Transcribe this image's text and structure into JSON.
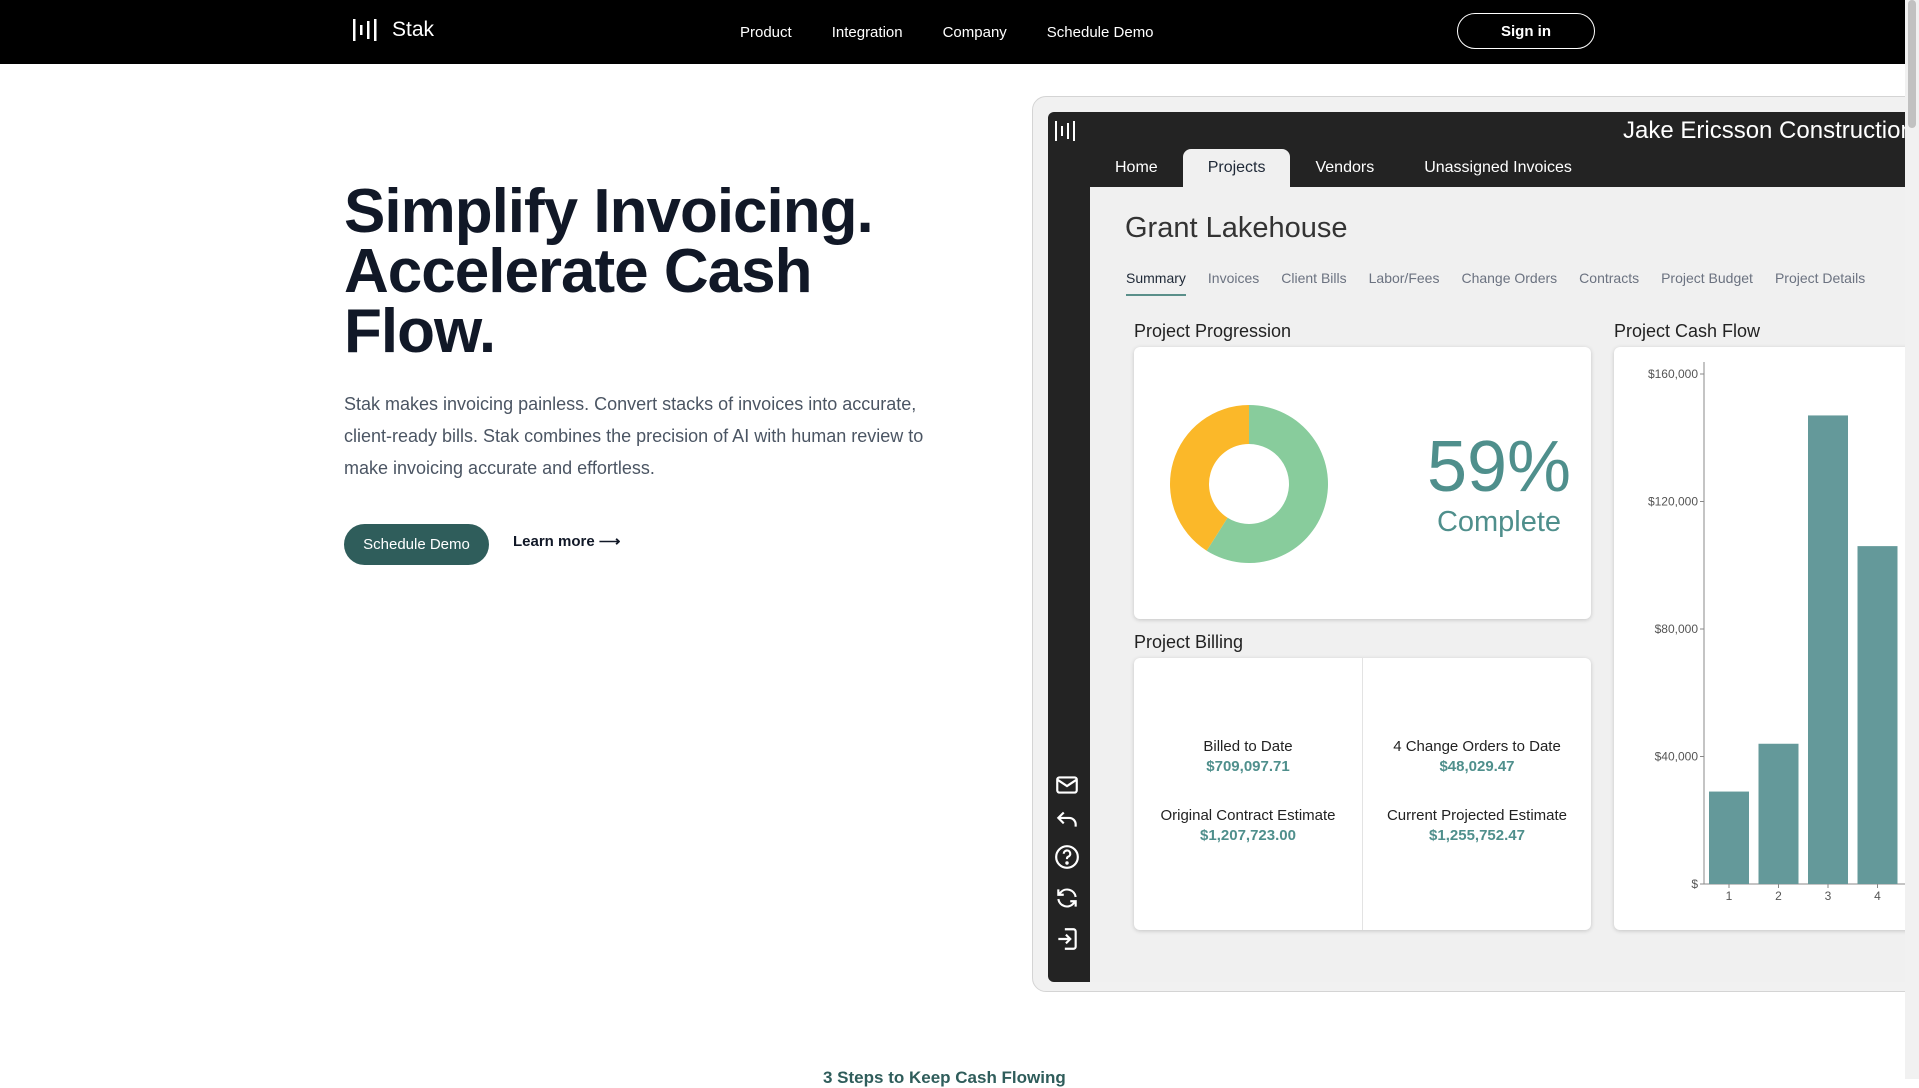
{
  "nav": {
    "logo_text": "Stak",
    "links": [
      "Product",
      "Integration",
      "Company",
      "Schedule Demo"
    ],
    "signin_label": "Sign in"
  },
  "hero": {
    "title": "Simplify Invoicing. Accelerate Cash Flow.",
    "description": "Stak makes invoicing painless. Convert stacks of invoices into accurate, client-ready bills. Stak combines the precision of AI with human review to make invoicing accurate and effortless.",
    "cta_label": "Schedule Demo",
    "learn_more_label": "Learn more ⟶"
  },
  "app": {
    "company_name": "Jake Ericsson Construction",
    "tabs": [
      "Home",
      "Projects",
      "Vendors",
      "Unassigned Invoices"
    ],
    "active_tab": "Projects",
    "project_title": "Grant Lakehouse",
    "subtabs": [
      "Summary",
      "Invoices",
      "Client Bills",
      "Labor/Fees",
      "Change Orders",
      "Contracts",
      "Project Budget",
      "Project Details"
    ],
    "active_subtab": "Summary",
    "side_icons": [
      "mail-icon",
      "undo-icon",
      "help-icon",
      "refresh-icon",
      "logout-icon"
    ],
    "progression": {
      "title": "Project Progression",
      "percent_text": "59%",
      "label": "Complete",
      "complete_fraction": 0.59,
      "colors": {
        "complete": "#88cc9c",
        "remaining": "#fbb829"
      }
    },
    "billing": {
      "title": "Project Billing",
      "items": [
        {
          "label": "Billed to Date",
          "value": "$709,097.71"
        },
        {
          "label": "4 Change Orders to Date",
          "value": "$48,029.47"
        },
        {
          "label": "Original Contract Estimate",
          "value": "$1,207,723.00"
        },
        {
          "label": "Current Projected Estimate",
          "value": "$1,255,752.47"
        }
      ]
    },
    "cash_flow_title": "Project Cash Flow"
  },
  "chart_data": {
    "type": "bar",
    "title": "Project Cash Flow",
    "categories": [
      "1",
      "2",
      "3",
      "4"
    ],
    "values": [
      29000,
      44000,
      147000,
      106000
    ],
    "ylim": [
      0,
      168000
    ],
    "yticks": [
      0,
      40000,
      80000,
      120000,
      160000
    ],
    "ytick_labels": [
      "$",
      "$40,000",
      "$80,000",
      "$120,000",
      "$160,000"
    ],
    "bar_color": "#64999a",
    "grid": false
  },
  "section_peek": {
    "text": "3 Steps to Keep Cash Flowing"
  }
}
